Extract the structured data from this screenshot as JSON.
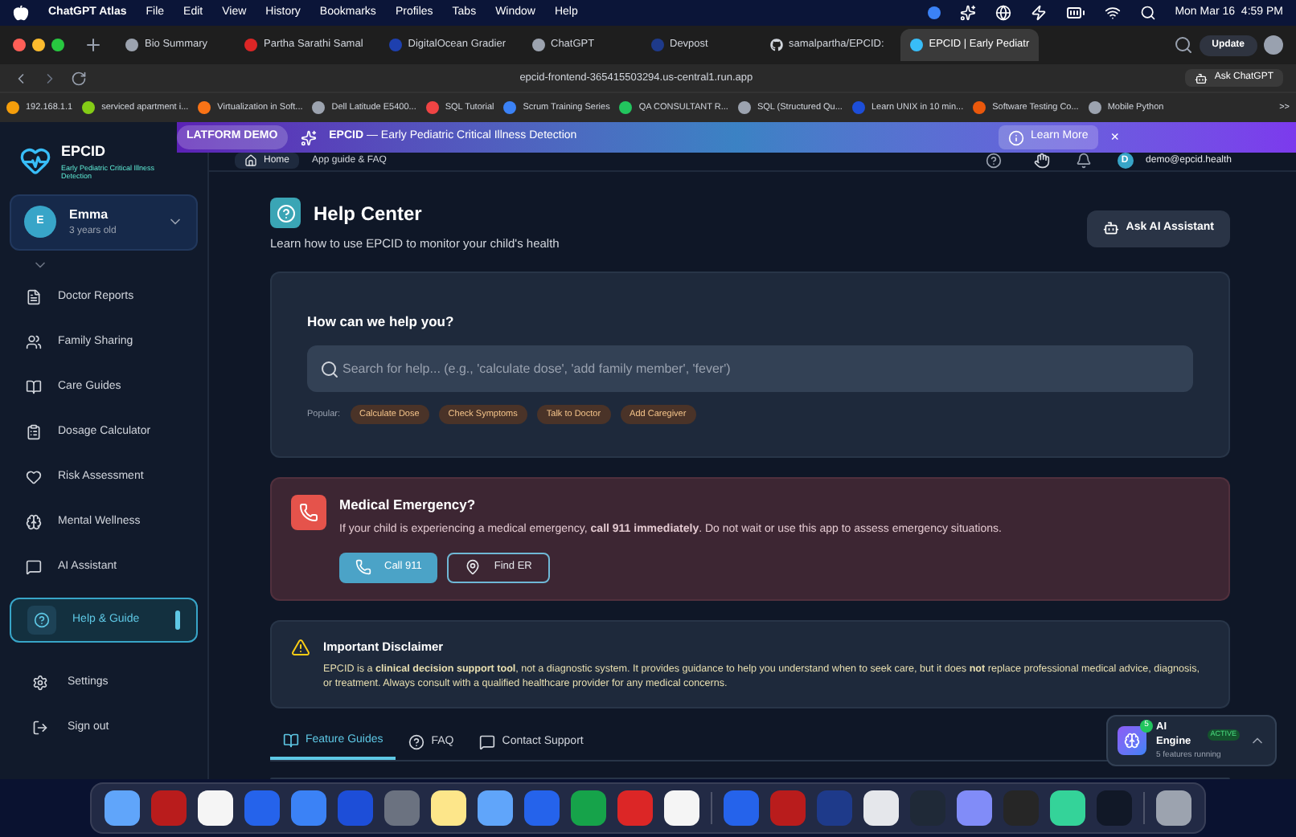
{
  "menubar": {
    "app": "ChatGPT Atlas",
    "menus": [
      "File",
      "Edit",
      "View",
      "History",
      "Bookmarks",
      "Profiles",
      "Tabs",
      "Window",
      "Help"
    ],
    "clock": "Mon Mar 16  4:59 PM"
  },
  "browser": {
    "tabs": [
      {
        "label": "Bio Summary",
        "selected": false
      },
      {
        "label": "Partha Sarathi Samal",
        "selected": false
      },
      {
        "label": "DigitalOcean Gradier",
        "selected": false
      },
      {
        "label": "ChatGPT",
        "selected": false
      },
      {
        "label": "Devpost",
        "selected": false
      },
      {
        "label": "samalpartha/EPCID:",
        "selected": false
      },
      {
        "label": "EPCID | Early Pediatr",
        "selected": true
      }
    ],
    "update_button": "Update",
    "url": "epcid-frontend-365415503294.us-central1.run.app",
    "ask_button": "Ask ChatGPT",
    "bookmarks": [
      "192.168.1.1",
      "serviced apartment i...",
      "Virtualization in Soft...",
      "Dell Latitude E5400...",
      "SQL Tutorial",
      "Scrum Training Series",
      "QA CONSULTANT R...",
      "SQL (Structured Qu...",
      "Learn UNIX in 10 min...",
      "Software Testing Co...",
      "Mobile Python"
    ],
    "more": ">>"
  },
  "banner": {
    "pill": "LATFORM DEMO",
    "text": "EPCID — Early Pediatric Critical Illness Detection",
    "button": "Learn More",
    "close": "×"
  },
  "sidebar": {
    "logo": "EPCID",
    "tagline": "Early Pediatric Critical Illness Detection",
    "profile": {
      "initial": "E",
      "name": "Emma",
      "age": "3 years old"
    },
    "items": [
      {
        "label": "Doctor Reports",
        "selected": false
      },
      {
        "label": "Family Sharing",
        "selected": false
      },
      {
        "label": "Care Guides",
        "selected": false
      },
      {
        "label": "Dosage Calculator",
        "selected": false
      },
      {
        "label": "Risk Assessment",
        "selected": false
      },
      {
        "label": "Mental Wellness",
        "selected": false
      },
      {
        "label": "AI Assistant",
        "selected": false
      },
      {
        "label": "Help & Guide",
        "selected": true
      }
    ],
    "footer": [
      "Settings",
      "Sign out"
    ]
  },
  "header": {
    "home": "Home",
    "subtitle": "App guide & FAQ",
    "avatar": "D",
    "email": "demo@epcid.health"
  },
  "page": {
    "title": "Help Center",
    "subtitle": "Learn how to use EPCID to monitor your child's health",
    "ask_button": "Ask AI Assistant",
    "search": {
      "heading": "How can we help you?",
      "placeholder": "Search for help... (e.g., 'calculate dose', 'add family member', 'fever')",
      "popular_label": "Popular:",
      "chips": [
        "Calculate Dose",
        "Check Symptoms",
        "Talk to Doctor",
        "Add Caregiver"
      ]
    },
    "emergency": {
      "title": "Medical Emergency?",
      "text": "If your child is experiencing a medical emergency, **call 911 immediately**. Do not wait or use this app to assess emergency situations.",
      "call_button": "Call 911",
      "find_button": "Find ER"
    },
    "disclaimer": {
      "title": "Important Disclaimer",
      "text": "EPCID is a **clinical decision support tool**, not a diagnostic system. It provides guidance to help you understand when to seek care, but it does **not** replace professional medical advice, diagnosis, or treatment. Always consult with a qualified healthcare provider for any medical concerns."
    },
    "tabs": [
      {
        "label": "Feature Guides",
        "selected": true
      },
      {
        "label": "FAQ",
        "selected": false
      },
      {
        "label": "Contact Support",
        "selected": false
      }
    ]
  },
  "ai_engine": {
    "badge_count": "5",
    "title": "AI Engine",
    "status": "ACTIVE",
    "subtitle": "5 features running"
  }
}
